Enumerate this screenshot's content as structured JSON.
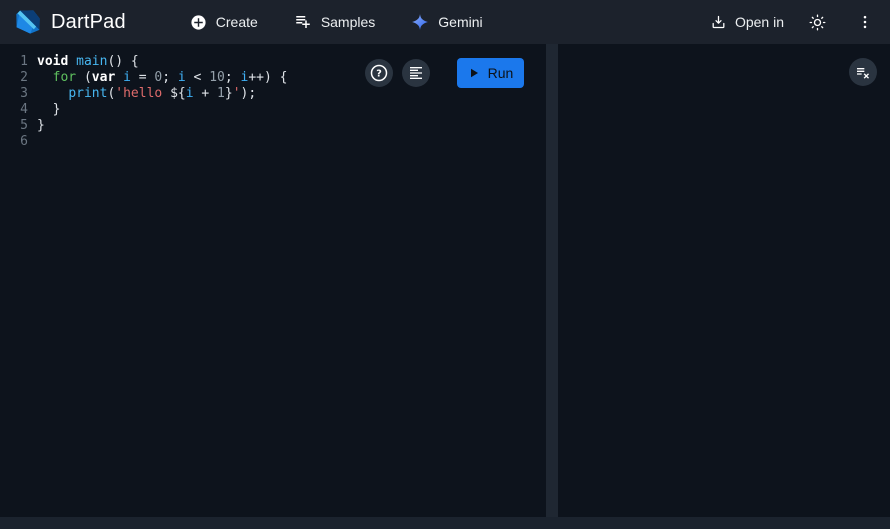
{
  "header": {
    "app_title": "DartPad",
    "nav": {
      "create_label": "Create",
      "samples_label": "Samples",
      "gemini_label": "Gemini"
    },
    "open_in_label": "Open in"
  },
  "editor": {
    "run_label": "Run",
    "plain_code": "void main() {\n  for (var i = 0; i < 10; i++) {\n    print('hello ${i + 1}');\n  }\n}\n",
    "code_lines": [
      {
        "n": "1",
        "tokens": [
          {
            "t": "void",
            "c": "kw"
          },
          {
            "t": " ",
            "c": "pl"
          },
          {
            "t": "main",
            "c": "fn"
          },
          {
            "t": "() {",
            "c": "pl"
          }
        ]
      },
      {
        "n": "2",
        "tokens": [
          {
            "t": "  ",
            "c": "pl"
          },
          {
            "t": "for",
            "c": "ctl"
          },
          {
            "t": " (",
            "c": "pl"
          },
          {
            "t": "var",
            "c": "kw"
          },
          {
            "t": " ",
            "c": "pl"
          },
          {
            "t": "i",
            "c": "vr"
          },
          {
            "t": " = ",
            "c": "pl"
          },
          {
            "t": "0",
            "c": "num"
          },
          {
            "t": "; ",
            "c": "pl"
          },
          {
            "t": "i",
            "c": "vr"
          },
          {
            "t": " < ",
            "c": "pl"
          },
          {
            "t": "10",
            "c": "num"
          },
          {
            "t": "; ",
            "c": "pl"
          },
          {
            "t": "i",
            "c": "vr"
          },
          {
            "t": "++) {",
            "c": "pl"
          }
        ]
      },
      {
        "n": "3",
        "tokens": [
          {
            "t": "    ",
            "c": "pl"
          },
          {
            "t": "print",
            "c": "fn"
          },
          {
            "t": "(",
            "c": "pl"
          },
          {
            "t": "'hello ",
            "c": "str"
          },
          {
            "t": "${",
            "c": "pl"
          },
          {
            "t": "i",
            "c": "vr"
          },
          {
            "t": " + ",
            "c": "pl"
          },
          {
            "t": "1",
            "c": "num"
          },
          {
            "t": "}",
            "c": "pl"
          },
          {
            "t": "'",
            "c": "str"
          },
          {
            "t": ");",
            "c": "pl"
          }
        ]
      },
      {
        "n": "4",
        "tokens": [
          {
            "t": "  }",
            "c": "pl"
          }
        ]
      },
      {
        "n": "5",
        "tokens": [
          {
            "t": "}",
            "c": "pl"
          }
        ]
      },
      {
        "n": "6",
        "tokens": []
      }
    ]
  },
  "console": {
    "output": ""
  },
  "icons": {
    "help_glyph": "?"
  },
  "colors": {
    "header_bg": "#1c222c",
    "panel_bg": "#0d131c",
    "divider": "#1f2732",
    "footer_bg": "#1b232e",
    "run_button": "#1b78ec",
    "circle_button": "#2a3440",
    "code_keyword": "#ffffff",
    "code_function": "#47b6f0",
    "code_control": "#5fc05f",
    "code_variable": "#3fb0f5",
    "code_number": "#94a0aa",
    "code_string": "#de6b6b",
    "line_number": "#6b7682"
  }
}
